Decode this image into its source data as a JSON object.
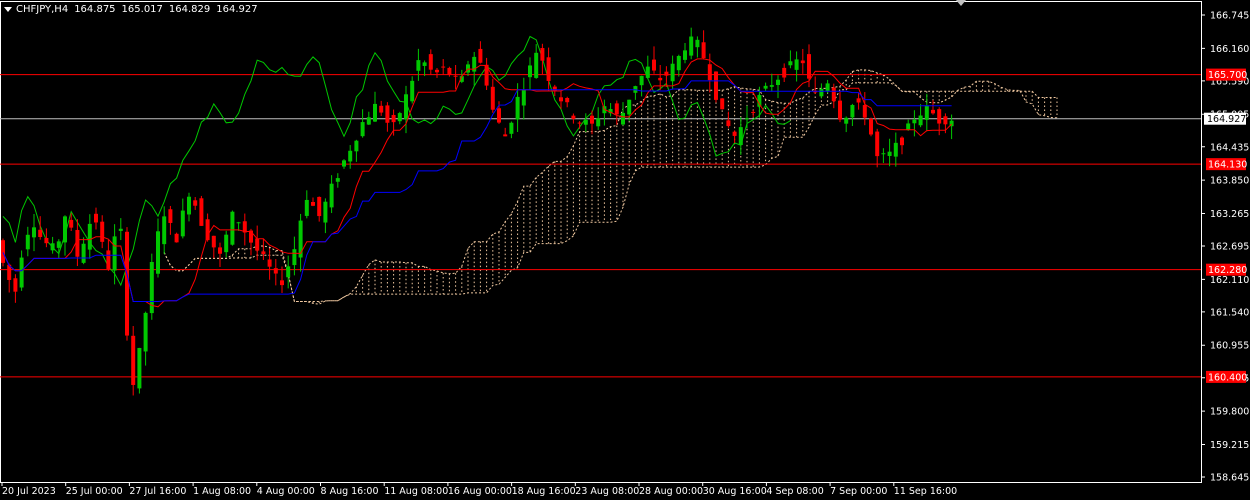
{
  "header": {
    "symbol_timeframe": "CHFJPY,H4",
    "open": "164.875",
    "high": "165.017",
    "low": "164.829",
    "close": "164.927"
  },
  "price_axis": {
    "ticks": [
      "166.745",
      "166.160",
      "165.590",
      "165.005",
      "164.435",
      "163.850",
      "163.265",
      "162.695",
      "162.110",
      "161.540",
      "160.955",
      "160.385",
      "159.800",
      "159.215",
      "158.645"
    ]
  },
  "time_axis": {
    "labels": [
      "20 Jul 2023",
      "25 Jul 00:00",
      "27 Jul 16:00",
      "1 Aug 08:00",
      "4 Aug 00:00",
      "8 Aug 16:00",
      "11 Aug 08:00",
      "16 Aug 00:00",
      "18 Aug 16:00",
      "23 Aug 08:00",
      "28 Aug 00:00",
      "30 Aug 16:00",
      "4 Sep 08:00",
      "7 Sep 00:00",
      "11 Sep 16:00"
    ]
  },
  "levels": [
    {
      "price": 165.7,
      "label": "165.700",
      "color": "#ff0000"
    },
    {
      "price": 164.13,
      "label": "164.130",
      "color": "#ff0000"
    },
    {
      "price": 162.28,
      "label": "162.280",
      "color": "#ff0000"
    },
    {
      "price": 160.4,
      "label": "160.400",
      "color": "#ff0000"
    }
  ],
  "current_price": {
    "price": 164.927,
    "label": "164.927",
    "color": "#ffffff"
  },
  "colors": {
    "background": "#000000",
    "bull_candle": "#00c800",
    "bear_candle": "#ff0000",
    "tenkan": "#ff0000",
    "kijun": "#0000ff",
    "chikou": "#00c800",
    "cloud": "#f0c8a0",
    "axis_text": "#ffffff",
    "border": "#ffffff"
  },
  "indicator": "Ichimoku Kinko Hyo"
}
